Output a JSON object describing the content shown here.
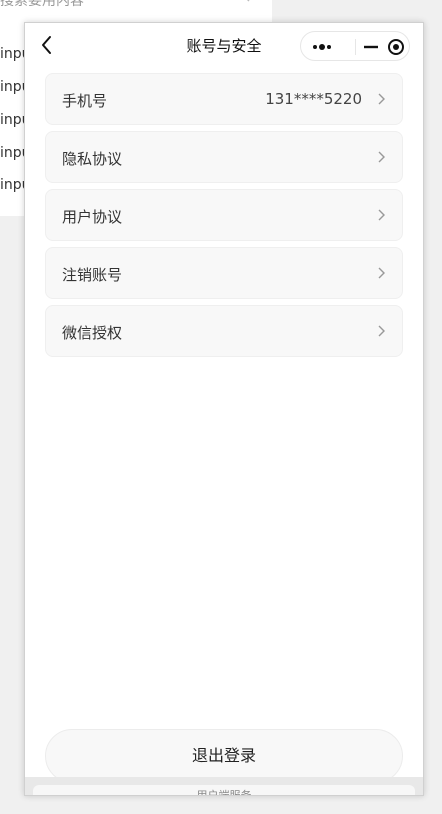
{
  "background": {
    "search_text": "搜索要用内容",
    "rows": [
      "input",
      "input",
      "input",
      "input",
      "input"
    ]
  },
  "navbar": {
    "title": "账号与安全"
  },
  "menu": {
    "items": [
      {
        "label": "手机号",
        "value": "131****5220"
      },
      {
        "label": "隐私协议",
        "value": ""
      },
      {
        "label": "用户协议",
        "value": ""
      },
      {
        "label": "注销账号",
        "value": ""
      },
      {
        "label": "微信授权",
        "value": ""
      }
    ]
  },
  "footer": {
    "logout_label": "退出登录",
    "bottom_bar_text": "用户端服务"
  },
  "colors": {
    "page_bg": "#f0f0f0",
    "item_bg": "#f8f8f8",
    "text": "#333333"
  },
  "icons": {
    "back": "chevron-left-icon",
    "more": "more-dots-icon",
    "minimize": "minimize-icon",
    "close": "target-circle-icon",
    "item_arrow": "chevron-right-icon"
  }
}
